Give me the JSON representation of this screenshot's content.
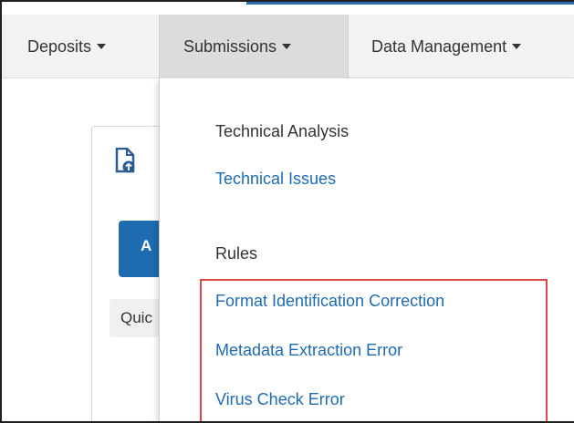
{
  "navbar": {
    "items": [
      {
        "label": "Deposits"
      },
      {
        "label": "Submissions"
      },
      {
        "label": "Data Management"
      }
    ]
  },
  "background_card": {
    "button_label": "A",
    "quick_label": "Quic"
  },
  "dropdown": {
    "entries": [
      {
        "label": "Technical Analysis",
        "kind": "header"
      },
      {
        "label": "Technical Issues",
        "kind": "link"
      },
      {
        "label": "Rules",
        "kind": "header"
      },
      {
        "label": "Format Identification Correction",
        "kind": "link"
      },
      {
        "label": "Metadata Extraction Error",
        "kind": "link"
      },
      {
        "label": "Virus Check Error",
        "kind": "link"
      }
    ]
  },
  "colors": {
    "link": "#1f6bb0",
    "highlight": "#e04848",
    "navbar_bg": "#f2f2f2",
    "active_tab_bg": "#dcdcdc"
  },
  "icons": [
    "caret-down-icon",
    "file-upload-icon"
  ]
}
